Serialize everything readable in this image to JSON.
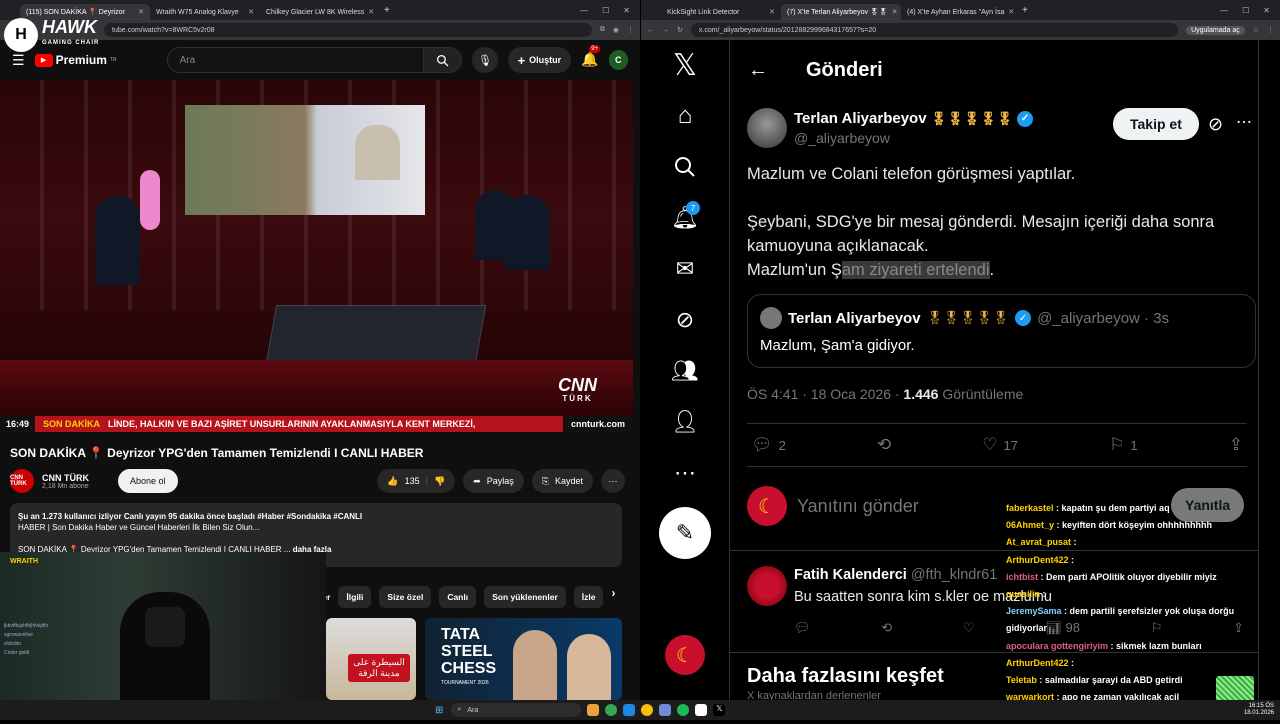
{
  "left_browser": {
    "tabs": [
      {
        "label": "(115) SON DAKİKA 📍 Deyrizor",
        "active": true
      },
      {
        "label": "Wraith W75 Analog Klavye",
        "active": false
      },
      {
        "label": "Chilkey Glacier LW 8K Wireless",
        "active": false
      }
    ],
    "url": "tube.com/watch?v=8WRC5v2r08"
  },
  "youtube": {
    "logo_text": "Premium",
    "logo_sup": "TR",
    "search_placeholder": "Ara",
    "create_label": "Oluştur",
    "notif_count": "9+",
    "avatar_letter": "C",
    "video": {
      "ticker_time": "16:49",
      "ticker_label": "SON DAKİKA",
      "ticker_text": "LİNDE, HALKIN VE BAZI AŞİRET UNSURLARININ AYAKLANMASIYLA KENT MERKEZİ,",
      "ticker_domain": "cnnturk.com",
      "brand": "CNN",
      "brand_sub": "TÜRK"
    },
    "title": "SON DAKİKA 📍 Deyrizor YPG'den Tamamen Temizlendi I CANLI HABER",
    "channel": {
      "name": "CNN TÜRK",
      "subs": "2,18 Mn abone",
      "logo": "CNN TÜRK"
    },
    "subscribe_label": "Abone ol",
    "like_count": "135",
    "share_label": "Paylaş",
    "save_label": "Kaydet",
    "description": {
      "line1": "Şu an 1.273 kullanıcı izliyor  Canlı yayın 95 dakika önce başladı  #Haber #Sondakika #CANLI",
      "line2": "HABER | Son Dakika Haber ve Güncel Haberleri İlk Bilen Siz Olun...",
      "line3": "SON DAKİKA 📍 Deyrizor YPG'den Tamamen Temizlendi I CANLI HABER ...",
      "more": "daha fazla"
    },
    "chips": [
      "İlgili",
      "Size özel",
      "Canlı",
      "Son yüklenenler",
      "İzle"
    ],
    "chip_partial": "ler",
    "thumb2_title": "TATA STEEL CHESS",
    "thumb2_sub": "TOURNAMENT 2026",
    "thumb1_text": "السيطرة على مدينة الرقة"
  },
  "overlay": {
    "hawk": "HAWK",
    "hawk_sub": "GAMING CHAIR",
    "cam_label": "WRAITH",
    "cam_chat": [
      "jkbvtftvjzhfhjhfvkjdfv",
      "sgrowavelive",
      "zlokdim",
      "Cinter geldi"
    ]
  },
  "right_browser": {
    "tabs": [
      {
        "label": "KickSight Link Detector",
        "active": false
      },
      {
        "label": "(7) X'te Terlan Aliyarbeyov 🎖🎖",
        "active": true
      },
      {
        "label": "(4) X'te Ayhan Erkaras \"Ayn İsa",
        "active": false
      }
    ],
    "url": "x.com/_aliyarbeyow/status/2012882999684317657?s=20",
    "app_button": "Uygulamada aç"
  },
  "x": {
    "header": "Gönderi",
    "notif_count": "7",
    "post": {
      "name": "Terlan Aliyarbeyov",
      "medals": "🎖🎖🎖🎖🎖",
      "handle": "@_aliyarbeyow",
      "follow_label": "Takip et",
      "text1": "Mazlum ve Colani telefon görüşmesi yaptılar.",
      "text2": "Şeybani, SDG'ye bir mesaj gönderdi. Mesajın içeriği daha sonra kamuoyuna açıklanacak.",
      "text3_a": "Mazlum'un Ş",
      "text3_hl": "am ziyareti ertelendi",
      "text3_b": ".",
      "quote": {
        "name": "Terlan Aliyarbeyov",
        "medals": "🎖🎖🎖🎖🎖",
        "handle": "@_aliyarbeyow · 3s",
        "text": "Mazlum, Şam'a gidiyor."
      },
      "time": "ÖS 4:41 · 18 Oca 2026 · ",
      "views": "1.446",
      "views_label": " Görüntüleme",
      "replies": "2",
      "likes": "17",
      "bookmarks": "1"
    },
    "reply_placeholder": "Yanıtını gönder",
    "reply_button": "Yanıtla",
    "comment": {
      "name": "Fatih Kalenderci",
      "handle": " @fth_klndr61",
      "text": "Bu saatten sonra kim s.kler oe mazlumu",
      "views": "98"
    },
    "explore_title": "Daha fazlasını keşfet",
    "explore_sub": "X kaynaklardan derlenenler"
  },
  "stream_chat": [
    {
      "user": "faberkastel",
      "msg": "kapatın şu dem partiyi aq",
      "cls": "u"
    },
    {
      "user": "06Ahmet_y",
      "msg": "keyiften dört köşeyim ohhhhhhhhh",
      "cls": "u"
    },
    {
      "user": "At_avrat_pusat",
      "msg": "",
      "cls": "u"
    },
    {
      "user": "ArthurDent422",
      "msg": "",
      "cls": "u"
    },
    {
      "user": "ichtbist",
      "msg": "Dem parti APOlitik oluyor diyebilir miyiz",
      "cls": "s"
    },
    {
      "user": "quasilin",
      "msg": "",
      "cls": "u"
    },
    {
      "user": "JeremySama",
      "msg": "dem partili şerefsizler yok oluşa dorğu gidiyorlar",
      "cls": "g"
    },
    {
      "user": "apoculara gottengiriyim",
      "msg": "sikmek lazm bunları",
      "cls": "s"
    },
    {
      "user": "ArthurDent422",
      "msg": "",
      "cls": "u"
    },
    {
      "user": "Teletab",
      "msg": "salmadılar şarayi da ABD getirdi",
      "cls": "u"
    },
    {
      "user": "warwarkort",
      "msg": "apo ne zaman yakılıcak acil",
      "cls": "u"
    },
    {
      "user": "lordanax",
      "msg": "Ayaklanma çağrısı var diyolar",
      "cls": "u"
    }
  ],
  "taskbar": {
    "search": "Ara",
    "time": "16:15 ÖS",
    "date": "18.01.2026"
  }
}
